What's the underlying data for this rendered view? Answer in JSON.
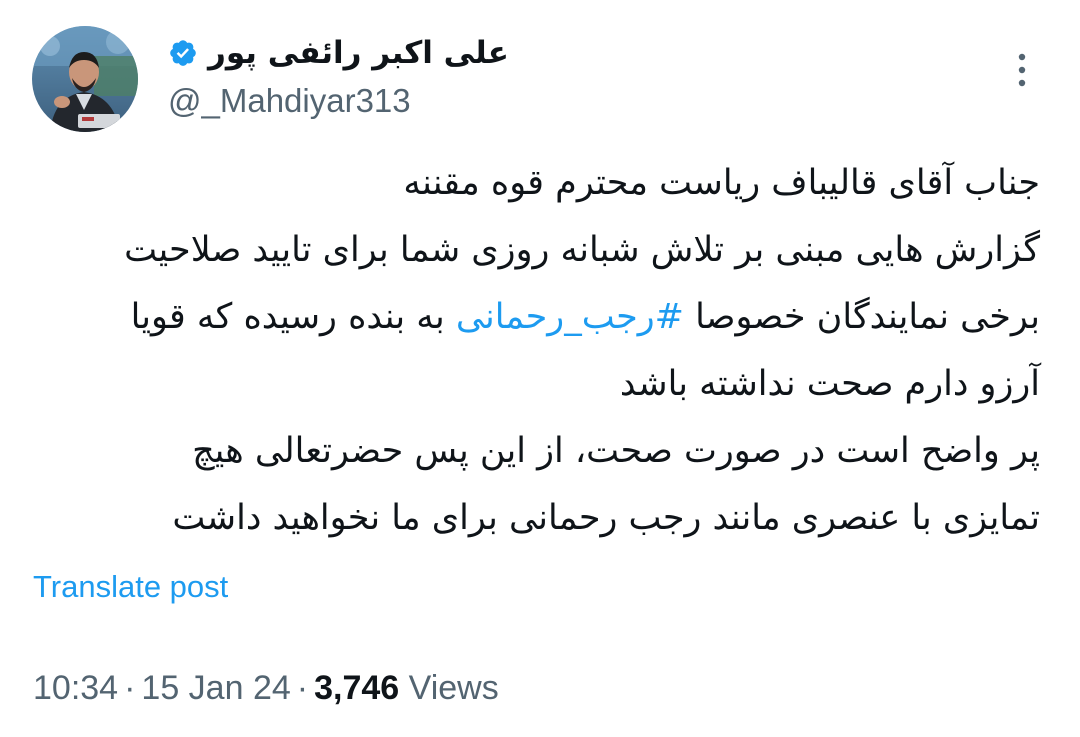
{
  "author": {
    "display_name": "علی اکبر رائفی پور",
    "handle": "@_Mahdiyar313",
    "verified": true,
    "verified_color": "#1d9bf0",
    "avatar_icon": "avatar-photo"
  },
  "menu": {
    "icon": "more-vertical-icon"
  },
  "tweet": {
    "lines": [
      {
        "pre": "جناب آقای قالیباف ریاست محترم قوه مقننه",
        "tag": "",
        "post": ""
      },
      {
        "pre": "گزارش هایی مبنی بر تلاش شبانه روزی شما برای تایید صلاحیت",
        "tag": "",
        "post": ""
      },
      {
        "pre": "برخی نمایندگان خصوصا ",
        "tag": "#رجب_رحمانی",
        "post": " به بنده رسیده که قویا"
      },
      {
        "pre": "آرزو دارم صحت نداشته باشد",
        "tag": "",
        "post": ""
      },
      {
        "pre": "پر واضح است در صورت صحت، از این پس حضرتعالی هیچ",
        "tag": "",
        "post": ""
      },
      {
        "pre": "تمایزی با عنصری مانند رجب رحمانی برای ما نخواهید داشت",
        "tag": "",
        "post": ""
      }
    ],
    "link_color": "#1d9bf0"
  },
  "translate": {
    "label": "Translate post"
  },
  "meta": {
    "time": "10:34",
    "date": "15 Jan 24",
    "views_count": "3,746",
    "views_label": "Views",
    "separator": "·"
  },
  "colors": {
    "text": "#0f1419",
    "secondary": "#536471",
    "accent": "#1d9bf0",
    "background": "#ffffff"
  }
}
